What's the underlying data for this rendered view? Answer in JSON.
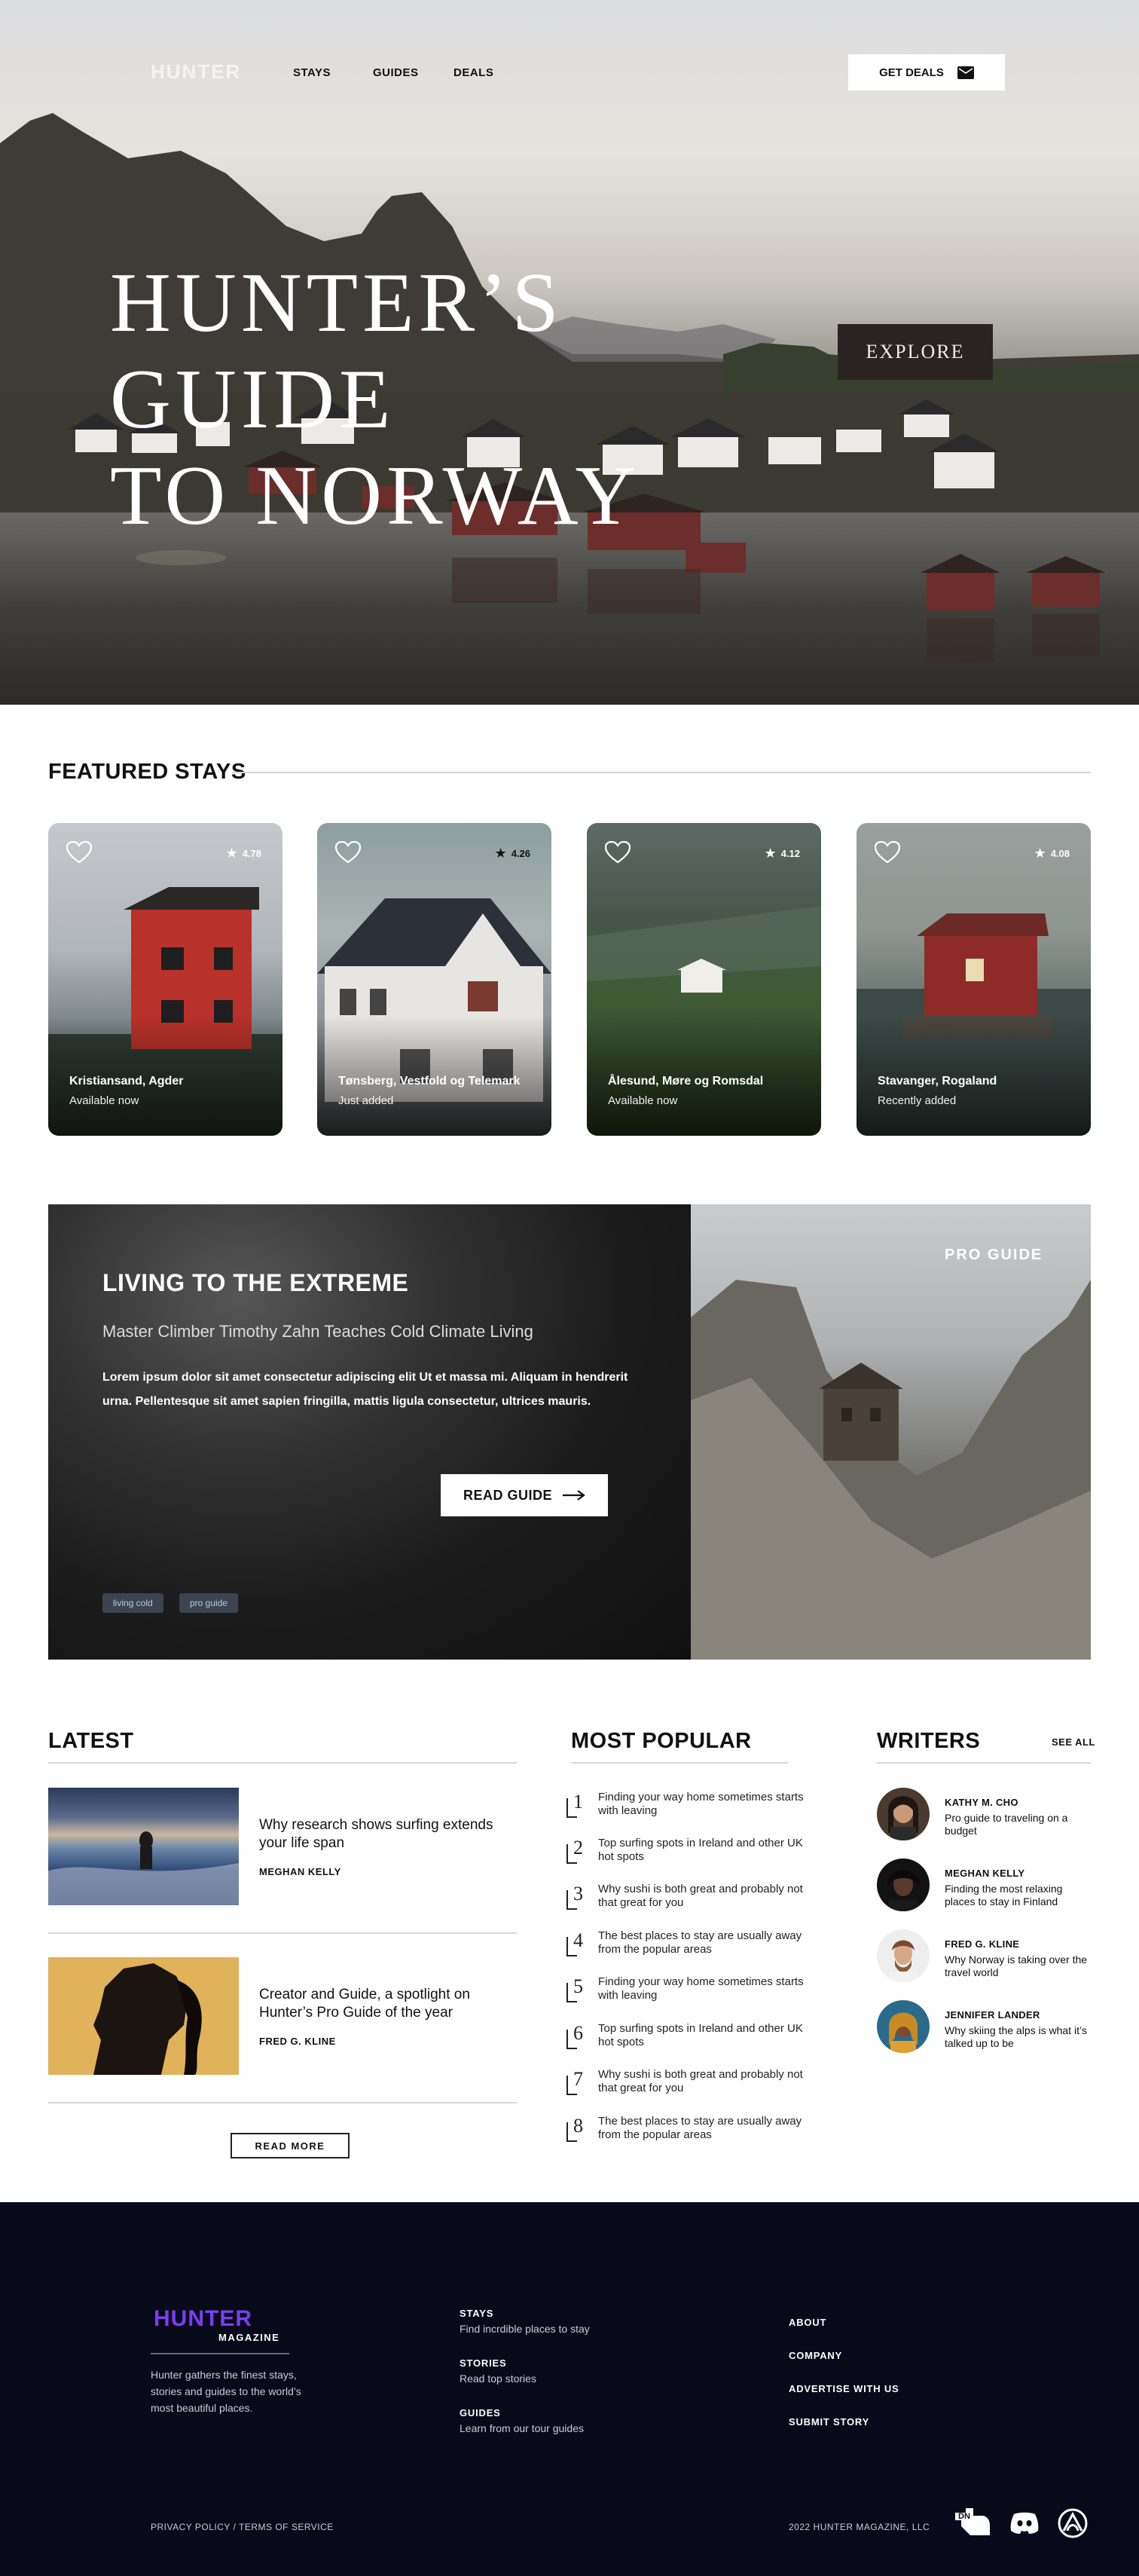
{
  "nav": {
    "logo": "HUNTER",
    "items": [
      "STAYS",
      "GUIDES",
      "DEALS"
    ],
    "cta": "GET DEALS"
  },
  "hero": {
    "title_line1": "HUNTER’S GUIDE",
    "title_line2": "TO NORWAY",
    "button": "EXPLORE"
  },
  "featured": {
    "heading": "FEATURED STAYS",
    "cards": [
      {
        "location": "Kristiansand, Agder",
        "status": "Available now",
        "rating": "4.78"
      },
      {
        "location": "Tønsberg, Vestfold og Telemark",
        "status": "Just added",
        "rating": "4.26"
      },
      {
        "location": "Ålesund, Møre og Romsdal",
        "status": "Available now",
        "rating": "4.12"
      },
      {
        "location": "Stavanger, Rogaland",
        "status": "Recently added",
        "rating": "4.08"
      }
    ]
  },
  "promo": {
    "title": "LIVING TO THE EXTREME",
    "subtitle": "Master Climber Timothy Zahn Teaches Cold Climate Living",
    "body": "Lorem ipsum dolor sit amet consectetur adipiscing elit Ut et massa mi. Aliquam in hendrerit urna. Pellentesque sit amet sapien fringilla, mattis ligula consectetur, ultrices mauris.",
    "button": "READ GUIDE",
    "tags": [
      "living cold",
      "pro guide"
    ],
    "badge": "PRO GUIDE"
  },
  "latest": {
    "heading": "LATEST",
    "items": [
      {
        "title": "Why research shows surfing extends your life span",
        "author": "MEGHAN KELLY"
      },
      {
        "title": "Creator and Guide, a spotlight on Hunter’s Pro Guide of the year",
        "author": "FRED G. KLINE"
      }
    ],
    "read_more": "READ MORE"
  },
  "popular": {
    "heading": "MOST POPULAR",
    "items": [
      {
        "num": "1",
        "text": "Finding your way home sometimes starts with leaving"
      },
      {
        "num": "2",
        "text": "Top surfing spots in Ireland and other UK hot spots"
      },
      {
        "num": "3",
        "text": "Why sushi is both great and probably not that great for you"
      },
      {
        "num": "4",
        "text": "The best places to stay are usually away from the popular areas"
      },
      {
        "num": "5",
        "text": "Finding your way home sometimes starts with leaving"
      },
      {
        "num": "6",
        "text": "Top surfing spots in Ireland and other UK hot spots"
      },
      {
        "num": "7",
        "text": "Why sushi is both great and probably not that great for you"
      },
      {
        "num": "8",
        "text": "The best places to stay are usually away from the popular areas"
      }
    ]
  },
  "writers": {
    "heading": "WRITERS",
    "see_all": "SEE ALL",
    "items": [
      {
        "name": "KATHY M. CHO",
        "desc": "Pro guide to traveling on a budget"
      },
      {
        "name": "MEGHAN KELLY",
        "desc": "Finding the most relaxing places to stay in Finland"
      },
      {
        "name": "FRED G. KLINE",
        "desc": "Why Norway is taking over the travel world"
      },
      {
        "name": "JENNIFER LANDER",
        "desc": "Why skiing the alps is what it’s talked up to be"
      }
    ]
  },
  "footer": {
    "logo": "HUNTER",
    "logo_sub": "MAGAZINE",
    "desc": "Hunter gathers the finest stays, stories and guides to the world’s most beautiful places.",
    "col1": [
      {
        "h": "STAYS",
        "s": "Find incrdible places to stay"
      },
      {
        "h": "STORIES",
        "s": "Read top stories"
      },
      {
        "h": "GUIDES",
        "s": "Learn from our tour guides"
      }
    ],
    "links": [
      "ABOUT",
      "COMPANY",
      "ADVERTISE WITH US",
      "SUBMIT STORY"
    ],
    "legal": "PRIVACY POLICY / TERMS OF SERVICE",
    "copyright": "2022 HUNTER MAGAZINE, LLC",
    "social_icons": [
      "hand-logo-icon",
      "discord-icon",
      "arch-logo-icon"
    ]
  },
  "colors": {
    "accent_purple": "#7b3df2",
    "footer_bg": "#080a19",
    "explore_bg": "#2b2223",
    "tag_bg": "#3b4450"
  }
}
